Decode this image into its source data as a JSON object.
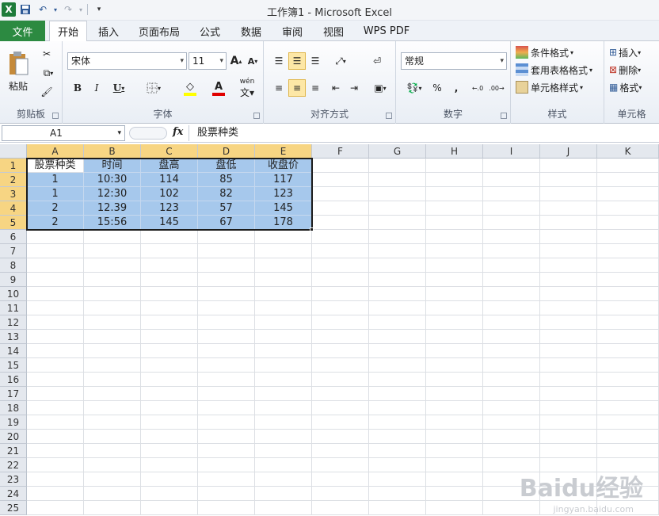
{
  "window": {
    "title": "工作簿1 - Microsoft Excel"
  },
  "tabs": [
    "文件",
    "开始",
    "插入",
    "页面布局",
    "公式",
    "数据",
    "审阅",
    "视图",
    "WPS PDF"
  ],
  "ribbon": {
    "clipboard": {
      "label": "剪贴板",
      "paste": "粘贴"
    },
    "font": {
      "label": "字体",
      "name": "宋体",
      "size": "11",
      "bold": "B",
      "italic": "I",
      "underline": "U",
      "grow": "A",
      "shrink": "A",
      "wen": "wén"
    },
    "alignment": {
      "label": "对齐方式"
    },
    "number": {
      "label": "数字",
      "format": "常规",
      "percent": "%",
      "comma": ","
    },
    "styles": {
      "label": "样式",
      "items": [
        "条件格式",
        "套用表格格式",
        "单元格样式"
      ]
    },
    "cells": {
      "label": "单元格",
      "items": [
        "插入",
        "删除",
        "格式"
      ]
    }
  },
  "formula_bar": {
    "name_box": "A1",
    "fx": "fx",
    "content": "股票种类"
  },
  "sheet": {
    "columns": [
      "A",
      "B",
      "C",
      "D",
      "E",
      "F",
      "G",
      "H",
      "I",
      "J",
      "K"
    ],
    "rows": [
      "1",
      "2",
      "3",
      "4",
      "5",
      "6",
      "7",
      "8",
      "9",
      "10",
      "11",
      "12",
      "13",
      "14",
      "15",
      "16",
      "17",
      "18",
      "19",
      "20",
      "21",
      "22",
      "23",
      "24",
      "25"
    ],
    "data": [
      [
        "股票种类",
        "时间",
        "盘高",
        "盘低",
        "收盘价"
      ],
      [
        "1",
        "10:30",
        "114",
        "85",
        "117"
      ],
      [
        "1",
        "12:30",
        "102",
        "82",
        "123"
      ],
      [
        "2",
        "12.39",
        "123",
        "57",
        "145"
      ],
      [
        "2",
        "15:56",
        "145",
        "67",
        "178"
      ]
    ]
  },
  "watermark": {
    "main": "Baidu经验",
    "sub": "jingyan.baidu.com"
  }
}
